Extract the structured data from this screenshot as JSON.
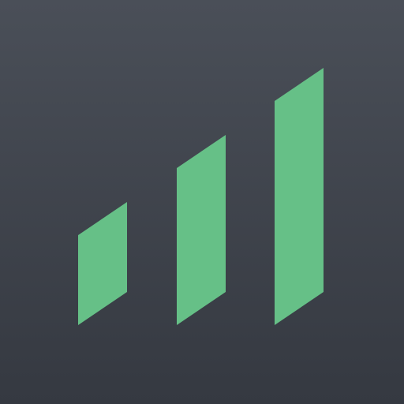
{
  "app_icon": {
    "icon": "signal-bars-icon",
    "colors": {
      "background_top": "#4a4f58",
      "background_bottom": "#353941",
      "bars": "#66c087"
    },
    "bars": [
      {
        "name": "bar-small"
      },
      {
        "name": "bar-medium"
      },
      {
        "name": "bar-large"
      }
    ]
  }
}
